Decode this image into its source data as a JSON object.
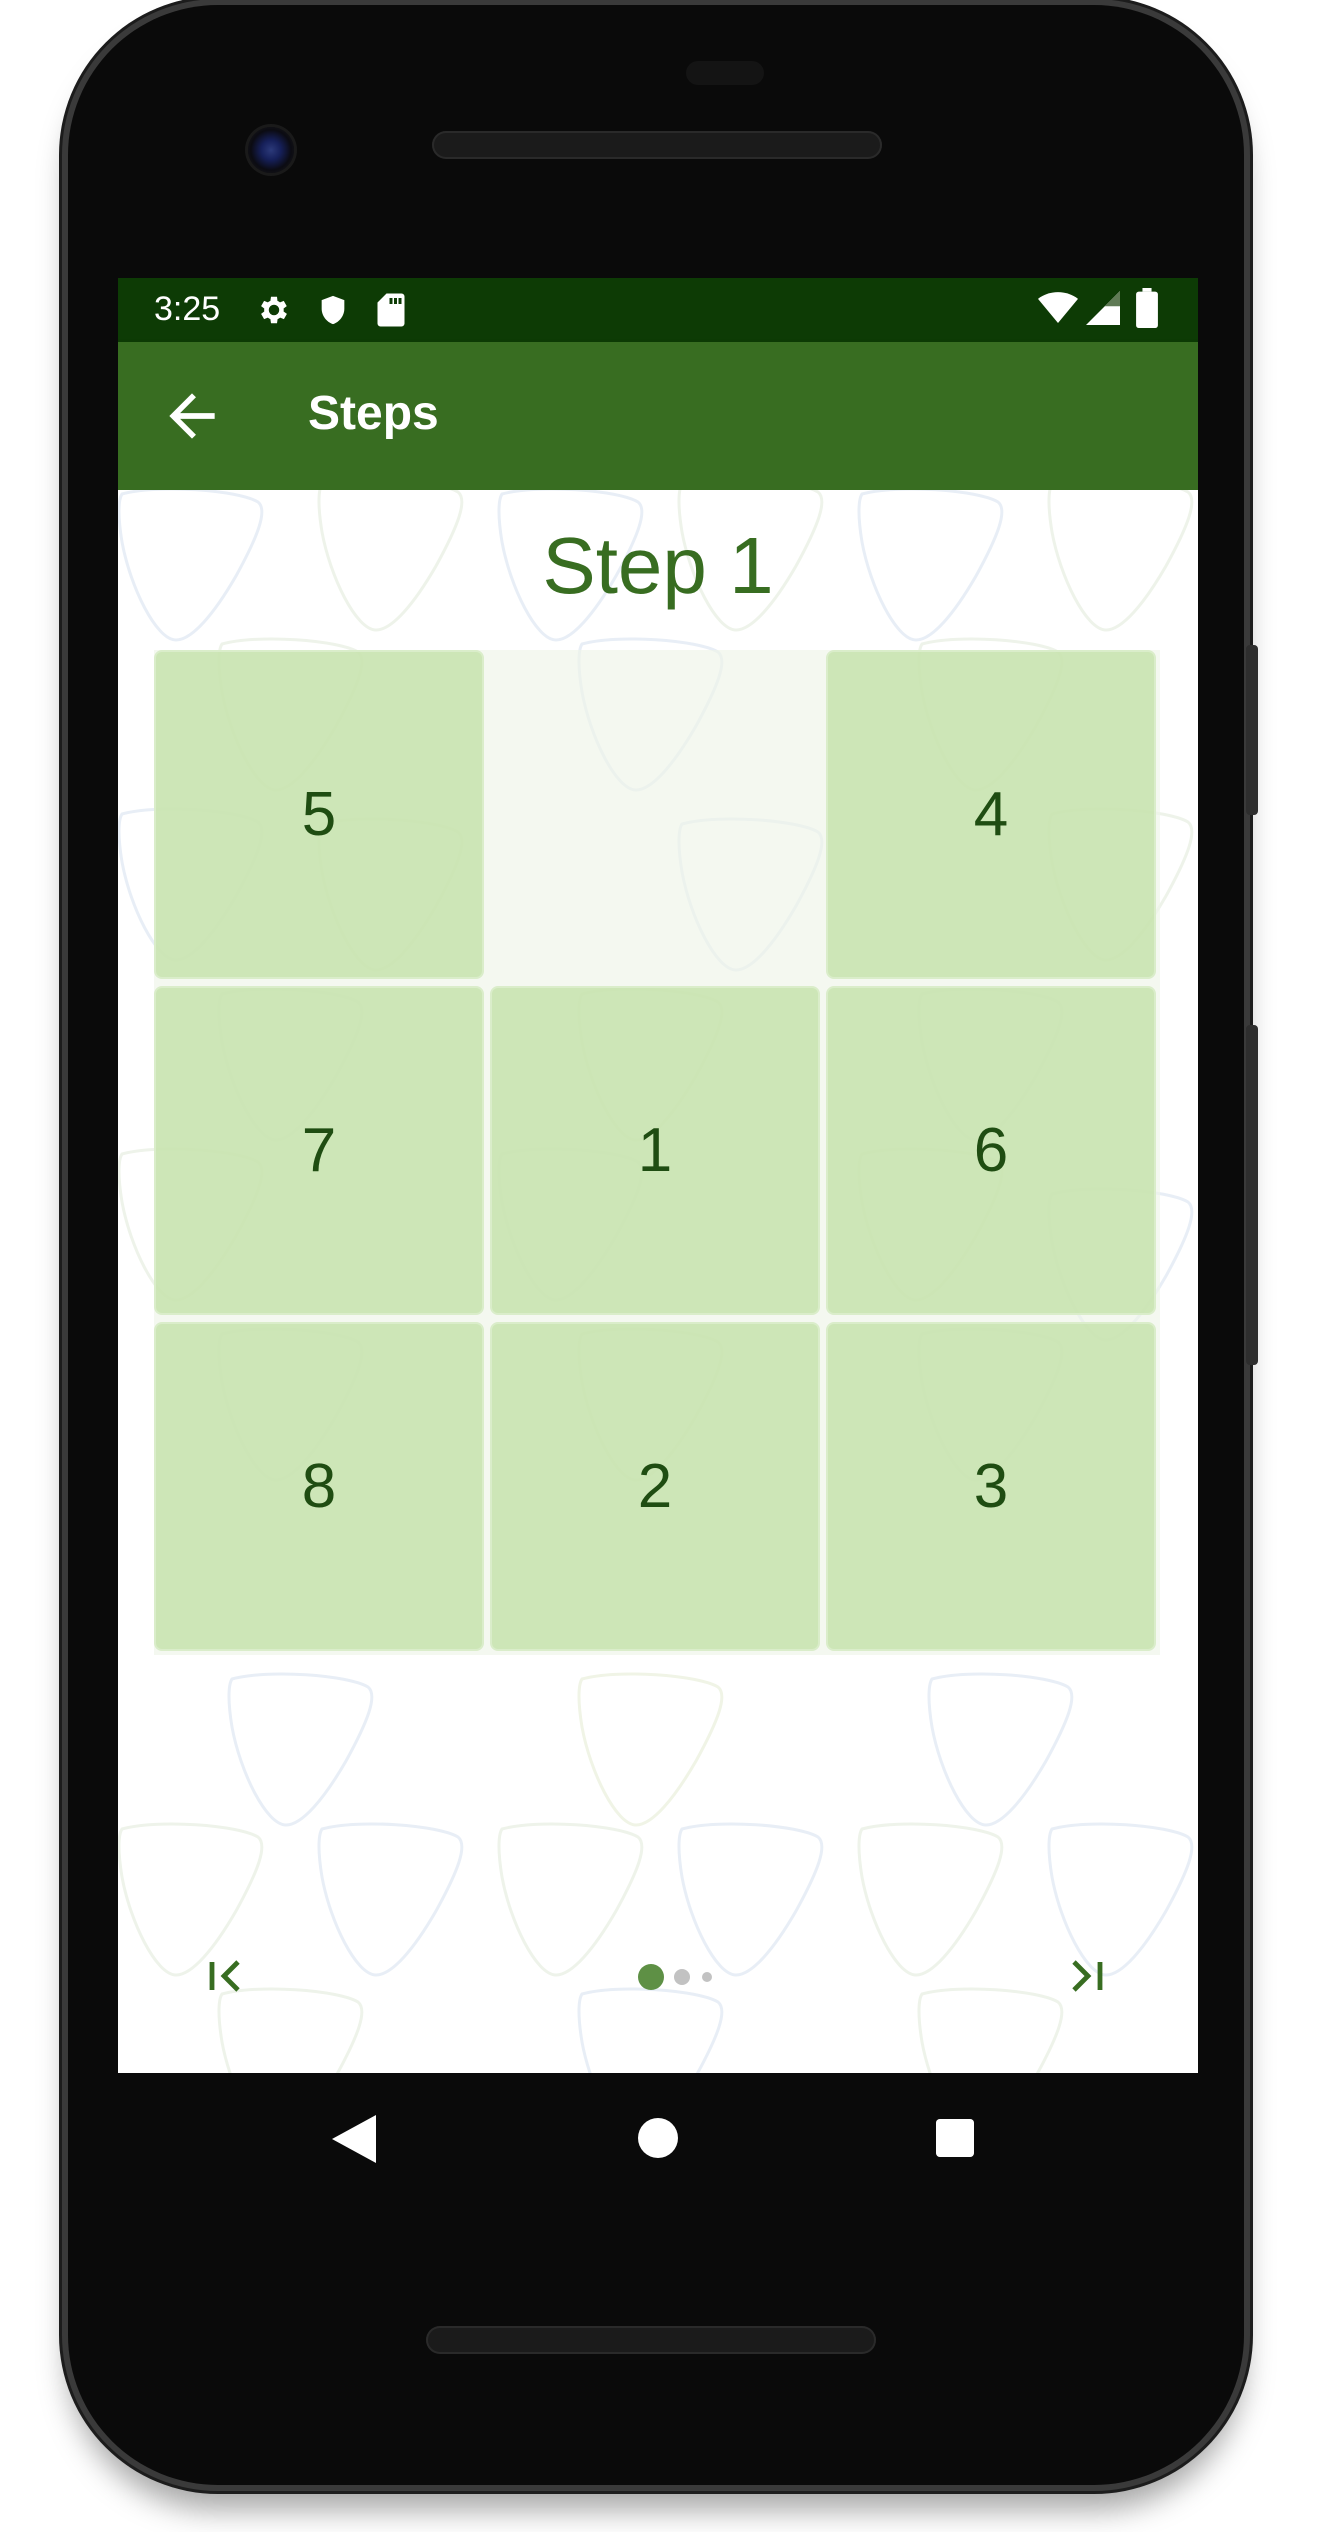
{
  "status_bar": {
    "time": "3:25",
    "left_icons": [
      "gear-icon",
      "shield-icon",
      "sd-card-icon"
    ],
    "right_icons": [
      "wifi-icon",
      "cell-signal-icon",
      "battery-icon"
    ]
  },
  "app_bar": {
    "back_icon": "arrow-left-icon",
    "title": "Steps"
  },
  "puzzle": {
    "heading": "Step 1",
    "grid": [
      [
        "5",
        "",
        "4"
      ],
      [
        "7",
        "1",
        "6"
      ],
      [
        "8",
        "2",
        "3"
      ]
    ]
  },
  "pager": {
    "first_icon": "skip-to-first-icon",
    "last_icon": "skip-to-last-icon",
    "page_count": 3,
    "current_page": 1
  },
  "system_nav": {
    "icons": [
      "nav-back-icon",
      "nav-home-icon",
      "nav-recents-icon"
    ]
  },
  "colors": {
    "status_bar": "#0d3b05",
    "app_bar": "#386d21",
    "accent": "#386d21",
    "tile": "#c4e2aa",
    "tile_text": "#1f4d12"
  }
}
